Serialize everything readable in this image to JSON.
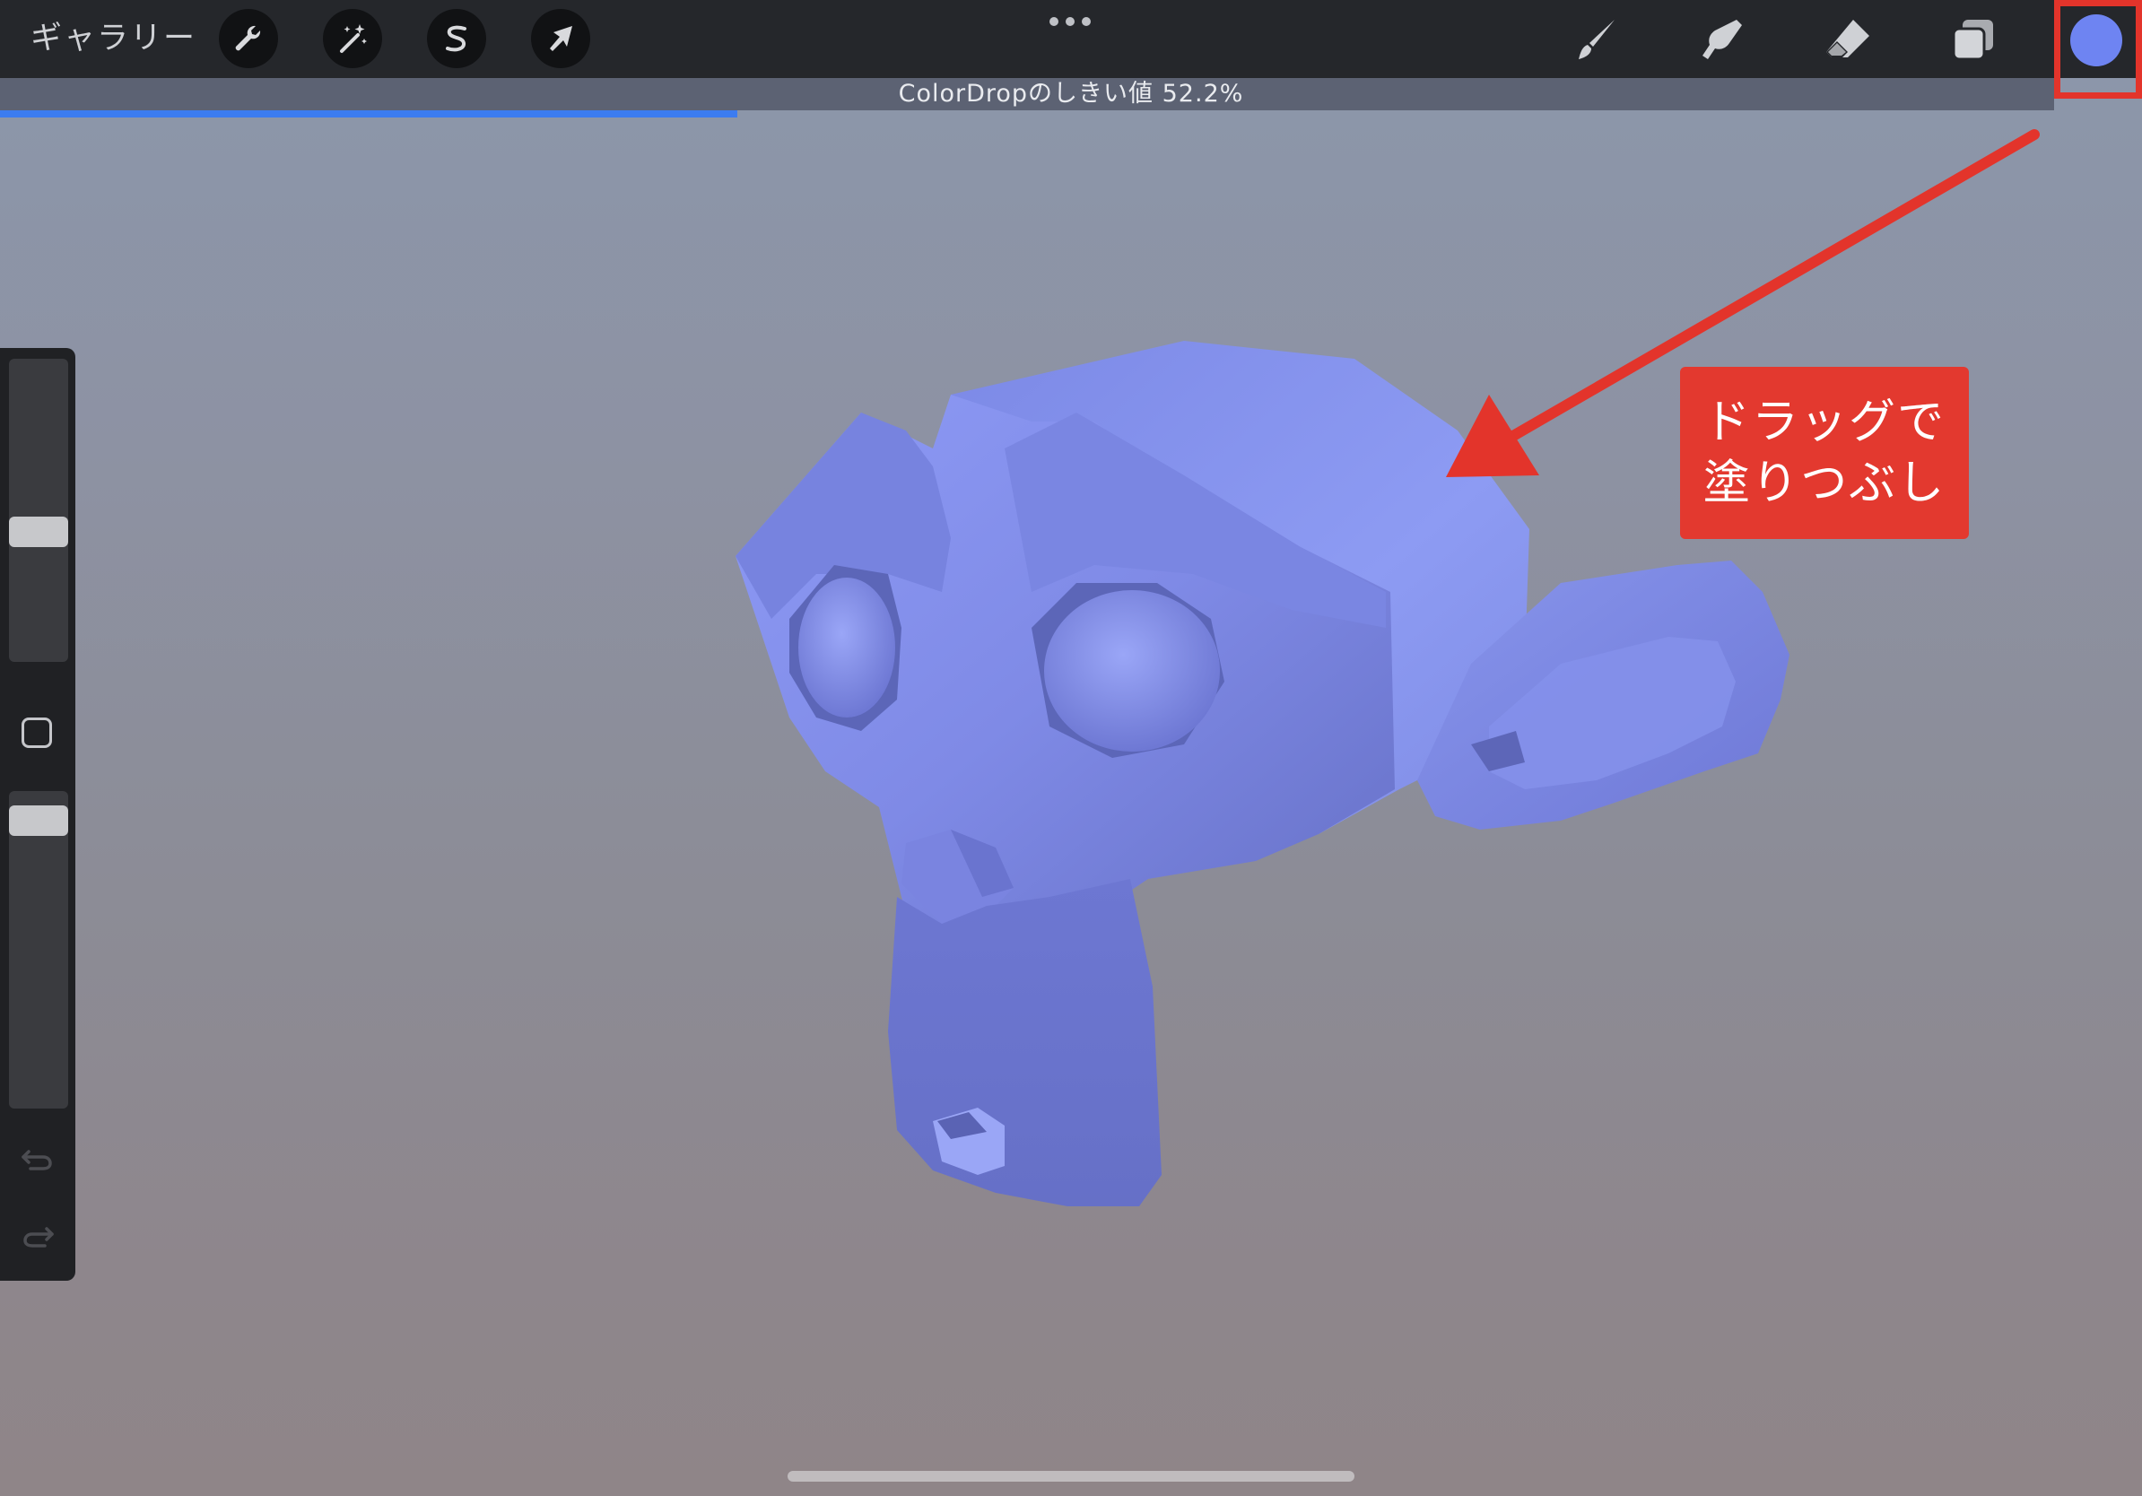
{
  "topbar": {
    "gallery_label": "ギャラリー",
    "left_tools": [
      {
        "name": "actions",
        "icon": "wrench-icon"
      },
      {
        "name": "adjustments",
        "icon": "magic-wand-icon"
      },
      {
        "name": "selection",
        "icon": "selection-s-icon"
      },
      {
        "name": "transform",
        "icon": "arrow-cursor-icon"
      }
    ],
    "more_icon": "more-dots-icon",
    "right_tools": [
      {
        "name": "brush",
        "icon": "brush-icon"
      },
      {
        "name": "smudge",
        "icon": "smudge-finger-icon"
      },
      {
        "name": "eraser",
        "icon": "eraser-icon"
      },
      {
        "name": "layers",
        "icon": "layers-icon"
      }
    ],
    "color_swatch": "#6e84f2"
  },
  "threshold": {
    "label": "ColorDropのしきい値 52.2%",
    "progress_fraction": 0.359,
    "fill_color": "#3c7cf0"
  },
  "sidebar": {
    "size_slider_level": 0.42,
    "opacity_slider_level": 0.95,
    "undo_icon": "undo-icon",
    "redo_icon": "redo-icon",
    "modify_icon": "square-modify-icon"
  },
  "annotation": {
    "line1": "ドラッグで",
    "line2": "塗りつぶし",
    "color": "#e3392f"
  },
  "model": {
    "fill_color": "#7f8ae8",
    "description_icon": "monkey-head-3d-model"
  }
}
